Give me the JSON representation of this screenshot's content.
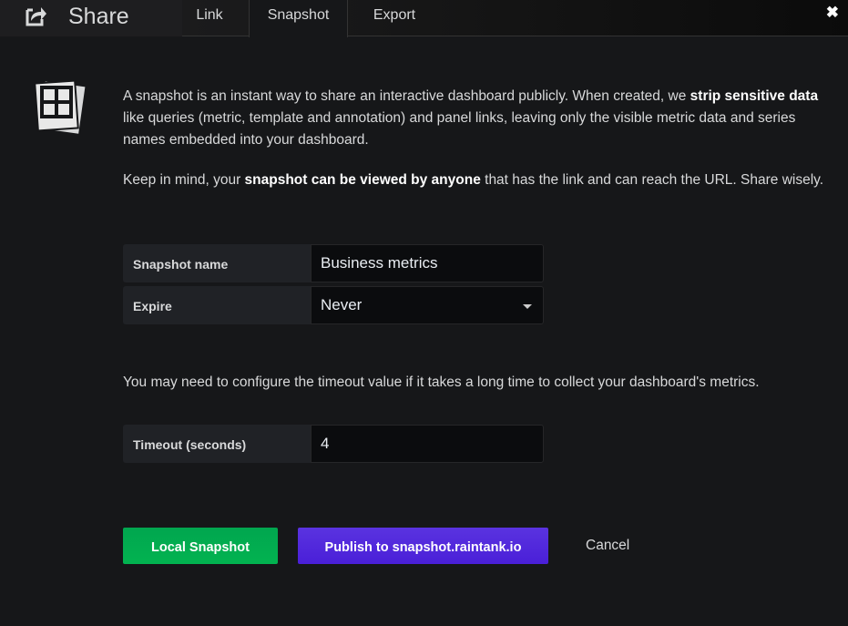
{
  "header": {
    "title": "Share",
    "icon": "share-icon",
    "tabs": [
      {
        "label": "Link"
      },
      {
        "label": "Snapshot",
        "active": true
      },
      {
        "label": "Export"
      }
    ],
    "close": "✖"
  },
  "intro": {
    "p1_a": "A snapshot is an instant way to share an interactive dashboard publicly. When created, we ",
    "p1_b": "strip sensitive data",
    "p1_c": " like queries (metric, template and annotation) and panel links, leaving only the visible metric data and series names embedded into your dashboard.",
    "p2_a": "Keep in mind, your ",
    "p2_b": "snapshot can be viewed by anyone",
    "p2_c": " that has the link and can reach the URL. Share wisely."
  },
  "form": {
    "name_label": "Snapshot name",
    "name_value": "Business metrics",
    "expire_label": "Expire",
    "expire_value": "Never",
    "timeout_note": "You may need to configure the timeout value if it takes a long time to collect your dashboard's metrics.",
    "timeout_label": "Timeout (seconds)",
    "timeout_value": "4"
  },
  "buttons": {
    "local": "Local Snapshot",
    "publish": "Publish to snapshot.raintank.io",
    "cancel": "Cancel"
  },
  "colors": {
    "local": "#02b350",
    "publish": "#5130dc",
    "background": "#161719"
  }
}
